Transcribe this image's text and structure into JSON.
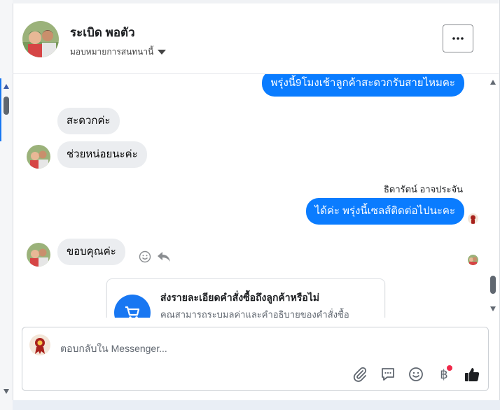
{
  "header": {
    "name": "ระเบิด พอตัว",
    "subtitle": "มอบหมายการสนทนานี้"
  },
  "messages": [
    {
      "text": "พรุ่งนี้9โมงเช้าลูกค้าสะดวกรับสายไหมคะ",
      "direction": "out"
    },
    {
      "text": "สะดวกค่ะ",
      "direction": "in"
    },
    {
      "text": "ช่วยหน่อยนะค่ะ",
      "direction": "in"
    },
    {
      "sender": "ธิดารัตน์ อาจประจัน"
    },
    {
      "text": "ได้ค่ะ พรุ่งนี้เซลส์ติดต่อไปนะคะ",
      "direction": "out"
    },
    {
      "text": "ขอบคุณค่ะ",
      "direction": "in"
    }
  ],
  "card": {
    "title": "ส่งรายละเอียดคำสั่งซื้อถึงลูกค้าหรือไม่",
    "description": "คุณสามารถระบุมูลค่าและคำอธิบายของคำสั่งซื้อ"
  },
  "composer": {
    "placeholder": "ตอบกลับใน Messenger...",
    "tools": [
      "paperclip-icon",
      "speech-bubble-icon",
      "emoji-icon",
      "baht-icon",
      "thumbs-up-icon"
    ],
    "baht_symbol": "฿"
  },
  "colors": {
    "outgoing": "#0a7cff",
    "incoming": "#ebedf0",
    "accent": "#1877f2",
    "notification": "#f02849"
  }
}
